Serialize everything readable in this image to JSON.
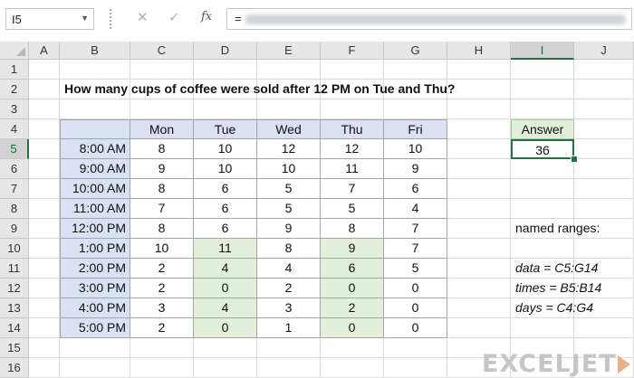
{
  "formula_bar": {
    "name_box": "I5",
    "cancel_icon": "✕",
    "enter_icon": "✓",
    "fx_label": "fx",
    "formula_prefix": "="
  },
  "columns": [
    "A",
    "B",
    "C",
    "D",
    "E",
    "F",
    "G",
    "H",
    "I",
    "J"
  ],
  "selected_column": "I",
  "rows": [
    "1",
    "2",
    "3",
    "4",
    "5",
    "6",
    "7",
    "8",
    "9",
    "10",
    "11",
    "12",
    "13",
    "14",
    "15",
    "16"
  ],
  "selected_row": "5",
  "sheet": {
    "title": "How many cups of coffee were sold after 12 PM on Tue and Thu?",
    "days": [
      "Mon",
      "Tue",
      "Wed",
      "Thu",
      "Fri"
    ],
    "times": [
      "8:00 AM",
      "9:00 AM",
      "10:00 AM",
      "11:00 AM",
      "12:00 PM",
      "1:00 PM",
      "2:00 PM",
      "3:00 PM",
      "4:00 PM",
      "5:00 PM"
    ],
    "data": [
      [
        "8",
        "10",
        "12",
        "12",
        "10"
      ],
      [
        "9",
        "10",
        "10",
        "11",
        "9"
      ],
      [
        "8",
        "6",
        "5",
        "7",
        "6"
      ],
      [
        "7",
        "6",
        "5",
        "5",
        "4"
      ],
      [
        "8",
        "6",
        "9",
        "8",
        "7"
      ],
      [
        "10",
        "11",
        "8",
        "9",
        "7"
      ],
      [
        "2",
        "4",
        "4",
        "6",
        "5"
      ],
      [
        "2",
        "0",
        "2",
        "0",
        "0"
      ],
      [
        "3",
        "4",
        "3",
        "2",
        "0"
      ],
      [
        "2",
        "0",
        "1",
        "0",
        "0"
      ]
    ],
    "answer_label": "Answer",
    "answer_value": "36",
    "named_ranges_label": "named ranges:",
    "named_ranges": [
      "data = C5:G14",
      "times = B5:B14",
      "days = C4:G4"
    ]
  },
  "colors": {
    "header_blue": "#dae1f3",
    "highlight_green": "#e2efda",
    "selection_green": "#217346"
  },
  "logo": {
    "text": "EXCELJET"
  }
}
